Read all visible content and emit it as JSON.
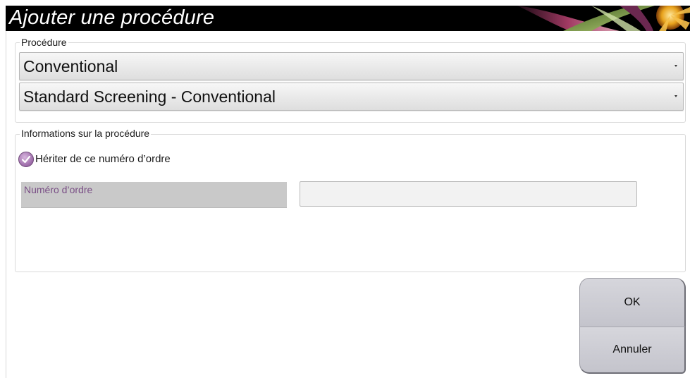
{
  "window": {
    "title": "Ajouter une procédure"
  },
  "procedure_group": {
    "legend": "Procédure",
    "dropdown_1": {
      "value": "Conventional"
    },
    "dropdown_2": {
      "value": "Standard Screening - Conventional"
    }
  },
  "info_group": {
    "legend": "Informations sur la procédure",
    "inherit_checkbox": {
      "label": "Hériter de ce numéro d’ordre",
      "checked": true
    },
    "accession": {
      "label": "Numéro d’ordre",
      "value": ""
    }
  },
  "buttons": {
    "ok_label": "OK",
    "cancel_label": "Annuler"
  },
  "colors": {
    "titlebar": "#000000",
    "accent_purple": "#9c6aa8",
    "field_label": "#7a4f86",
    "button_face": "#cdcdd4"
  }
}
